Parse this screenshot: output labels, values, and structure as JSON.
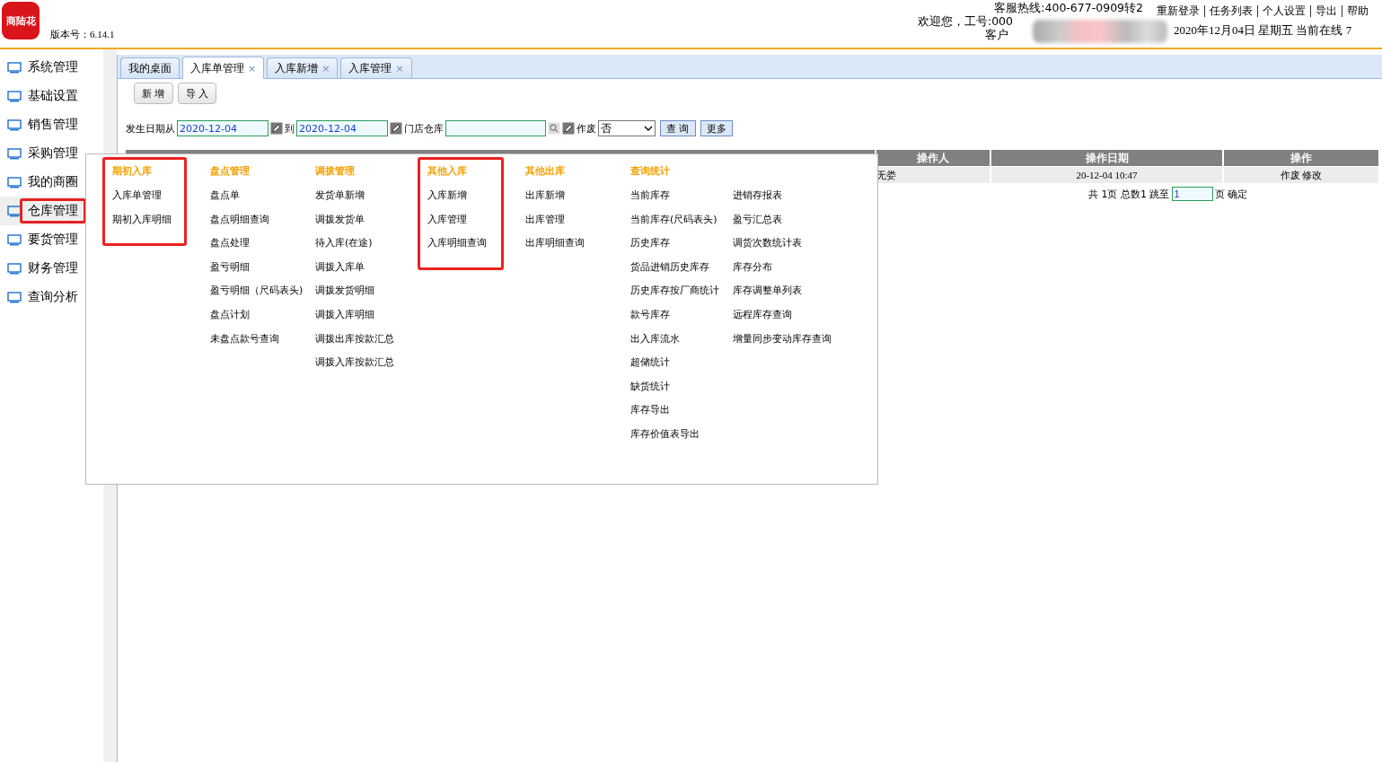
{
  "header": {
    "logo": "商陆花",
    "version": "版本号：6.14.1",
    "hotline": "客服热线:400-677-0909转2",
    "welcome": "欢迎您，工号:000",
    "customer": "客户",
    "links": [
      "重新登录",
      "任务列表",
      "个人设置",
      "导出",
      "帮助"
    ],
    "date_line": "2020年12月04日 星期五 当前在线 7"
  },
  "sidebar": {
    "items": [
      {
        "label": "系统管理",
        "selected": false
      },
      {
        "label": "基础设置",
        "selected": false
      },
      {
        "label": "销售管理",
        "selected": false
      },
      {
        "label": "采购管理",
        "selected": false
      },
      {
        "label": "我的商圈",
        "selected": false
      },
      {
        "label": "仓库管理",
        "selected": true
      },
      {
        "label": "要货管理",
        "selected": false
      },
      {
        "label": "财务管理",
        "selected": false
      },
      {
        "label": "查询分析",
        "selected": false
      }
    ]
  },
  "tabs": [
    {
      "label": "我的桌面",
      "selected": false,
      "closable": false
    },
    {
      "label": "入库单管理",
      "selected": true,
      "closable": true
    },
    {
      "label": "入库新增",
      "selected": false,
      "closable": true
    },
    {
      "label": "入库管理",
      "selected": false,
      "closable": true
    }
  ],
  "close_glyph": "×",
  "toolbar": [
    "新 增",
    "导 入"
  ],
  "filter": {
    "date_from_label": "发生日期从",
    "date_from": "2020-12-04",
    "date_to_label": "到",
    "date_to": "2020-12-04",
    "store_label": "门店仓库",
    "void_label": "作废",
    "void_value": "否",
    "buttons": [
      "查 询",
      "更多"
    ]
  },
  "table": {
    "columns": [
      "操作人",
      "操作日期",
      "操作"
    ],
    "rows": [
      [
        "无娄",
        "20-12-04 10:47",
        "作废 修改"
      ]
    ]
  },
  "pagination": {
    "before": "共 1页 总数1 跳至",
    "page": "1",
    "after": "页 确定"
  },
  "menu": {
    "groups": [
      {
        "title": "期初入库",
        "highlighted": true,
        "items": [
          "入库单管理",
          "期初入库明细"
        ]
      },
      {
        "title": "盘点管理",
        "highlighted": false,
        "items": [
          "盘点单",
          "盘点明细查询",
          "盘点处理",
          "盈亏明细",
          "盈亏明细（尺码表头)",
          "盘点计划",
          "未盘点款号查询"
        ]
      },
      {
        "title": "调拨管理",
        "highlighted": false,
        "items": [
          "发货单新增",
          "调拨发货单",
          "待入库(在途)",
          "调拨入库单",
          "调拨发货明细",
          "调拨入库明细",
          "调拨出库按款汇总",
          "调拨入库按款汇总"
        ]
      },
      {
        "title": "其他入库",
        "highlighted": true,
        "items": [
          "入库新增",
          "入库管理",
          "入库明细查询"
        ]
      },
      {
        "title": "其他出库",
        "highlighted": false,
        "items": [
          "出库新增",
          "出库管理",
          "出库明细查询"
        ]
      },
      {
        "title": "查询统计",
        "highlighted": false,
        "items": [
          "当前库存",
          "当前库存(尺码表头)",
          "历史库存",
          "货品进销历史库存",
          "历史库存按厂商统计",
          "款号库存",
          "出入库流水",
          "超储统计",
          "缺货统计",
          "库存导出",
          "库存价值表导出"
        ]
      },
      {
        "highlighted": false,
        "items": [
          "进销存报表",
          "盈亏汇总表",
          "调货次数统计表",
          "库存分布",
          "库存调整单列表",
          "远程库存查询",
          "增量同步变动库存查询"
        ]
      }
    ]
  }
}
